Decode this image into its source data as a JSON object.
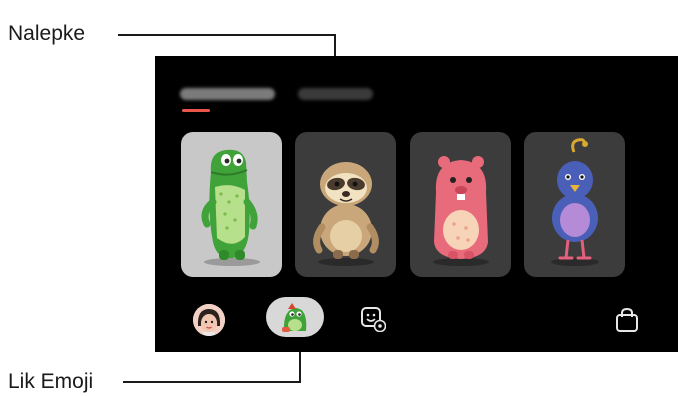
{
  "callouts": {
    "stickers_label": "Nalepke",
    "emoji_character_label": "Lik Emoji"
  },
  "screen": {
    "tabs": [
      {
        "name": "tab-my-emoji",
        "selected": true
      },
      {
        "name": "tab-stickers",
        "selected": false
      }
    ],
    "characters": [
      {
        "name": "green-dinosaur",
        "selected": true
      },
      {
        "name": "sloth",
        "selected": false
      },
      {
        "name": "pink-beaver",
        "selected": false
      },
      {
        "name": "blue-bird",
        "selected": false
      }
    ],
    "bottom_bar": {
      "icons": [
        "avatar-icon",
        "emoji-character-icon",
        "sticker-settings-icon",
        "shop-bag-icon"
      ]
    }
  },
  "colors": {
    "screen_bg": "#000000",
    "accent_underline": "#e9564c",
    "selected_card": "#c8c8c8",
    "card": "#3c3c3c"
  }
}
